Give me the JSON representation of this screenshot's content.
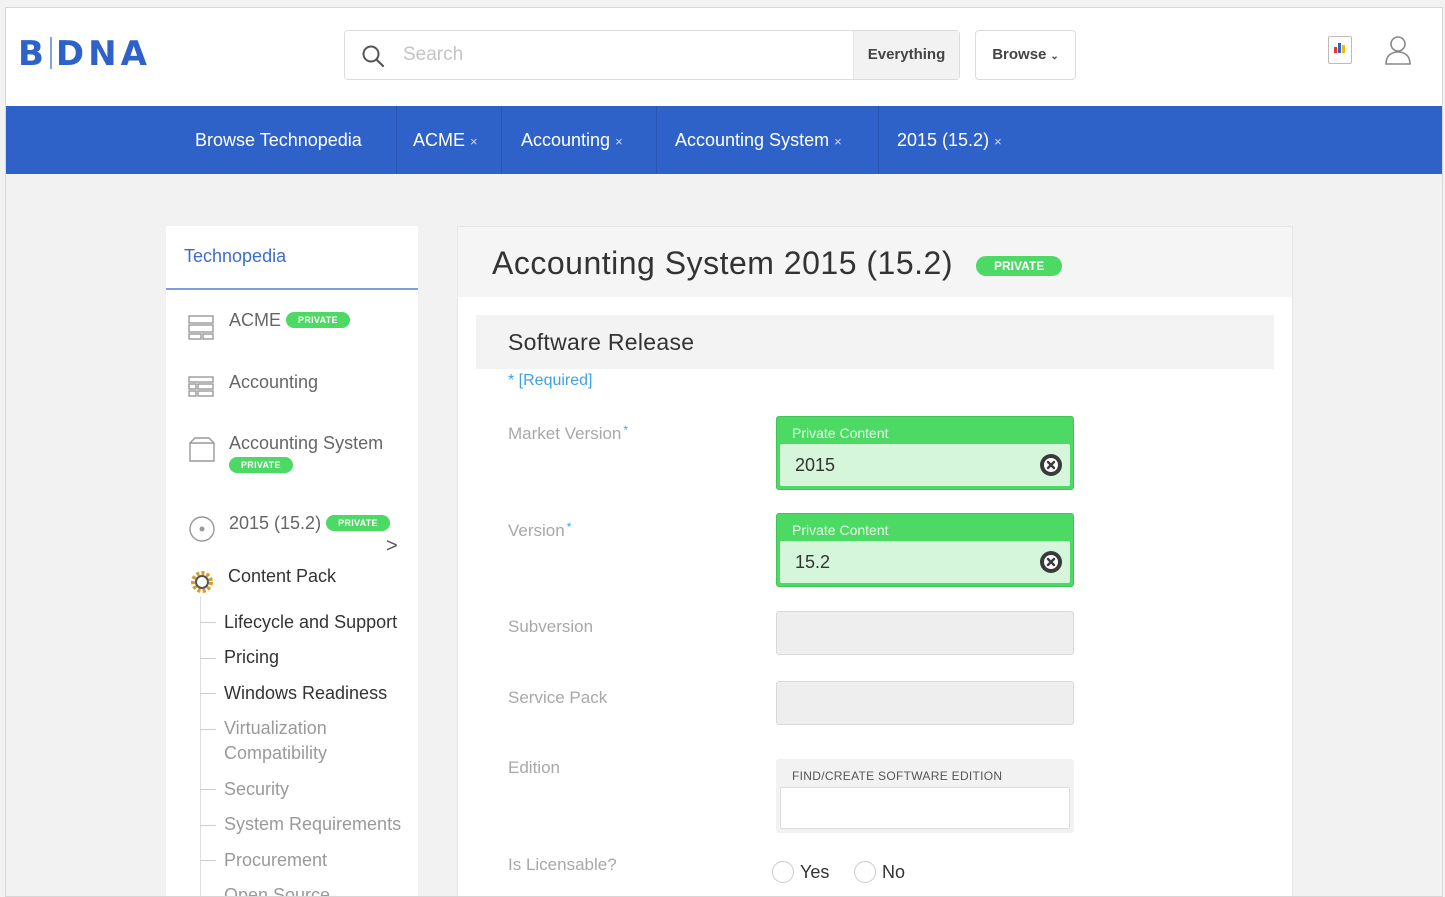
{
  "header": {
    "logo": "BDNA",
    "search": {
      "placeholder": "Search",
      "scope": "Everything"
    },
    "browse_label": "Browse",
    "icons": [
      "search-icon",
      "chevron-down-icon",
      "chart-icon",
      "user-icon"
    ]
  },
  "nav": {
    "items": [
      {
        "label": "Browse Technopedia"
      },
      {
        "label": "ACME",
        "close": "×"
      },
      {
        "label": "Accounting",
        "close": "×"
      },
      {
        "label": "Accounting System",
        "close": "×"
      },
      {
        "label": "2015 (15.2)",
        "close": "×"
      }
    ]
  },
  "sidebar": {
    "title": "Technopedia",
    "tree": [
      {
        "label": "ACME",
        "badge": "PRIVATE",
        "icon": "manufacturer-icon"
      },
      {
        "label": "Accounting",
        "icon": "category-icon"
      },
      {
        "label": "Accounting System",
        "badge": "PRIVATE",
        "icon": "product-icon"
      },
      {
        "label": "2015 (15.2)",
        "badge": "PRIVATE",
        "icon": "release-icon"
      },
      {
        "label": "Content Pack",
        "icon": "gear-icon"
      }
    ],
    "expand_arrow": ">",
    "content_pack_items": [
      "Lifecycle and Support",
      "Pricing",
      "Windows Readiness",
      "Virtualization",
      "Compatibility",
      "Security",
      "System Requirements",
      "Procurement",
      "Open Source"
    ]
  },
  "main": {
    "title": "Accounting System 2015 (15.2)",
    "badge": "PRIVATE",
    "section_title": "Software Release",
    "required_note": "* [Required]",
    "fields": {
      "market_version": {
        "label": "Market Version",
        "caption": "Private Content",
        "value": "2015"
      },
      "version": {
        "label": "Version",
        "caption": "Private Content",
        "value": "15.2"
      },
      "subversion": {
        "label": "Subversion",
        "value": ""
      },
      "service_pack": {
        "label": "Service Pack",
        "value": ""
      },
      "edition": {
        "label": "Edition",
        "caption": "FIND/CREATE SOFTWARE EDITION",
        "value": ""
      },
      "is_licensable": {
        "label": "Is Licensable?",
        "options": [
          "Yes",
          "No"
        ]
      }
    },
    "required_marker": "*"
  },
  "colors": {
    "brand_blue": "#2f62c8",
    "private_green": "#4cd964",
    "private_field_bg": "#d6f6dc",
    "required_blue": "#3fa0e8"
  }
}
